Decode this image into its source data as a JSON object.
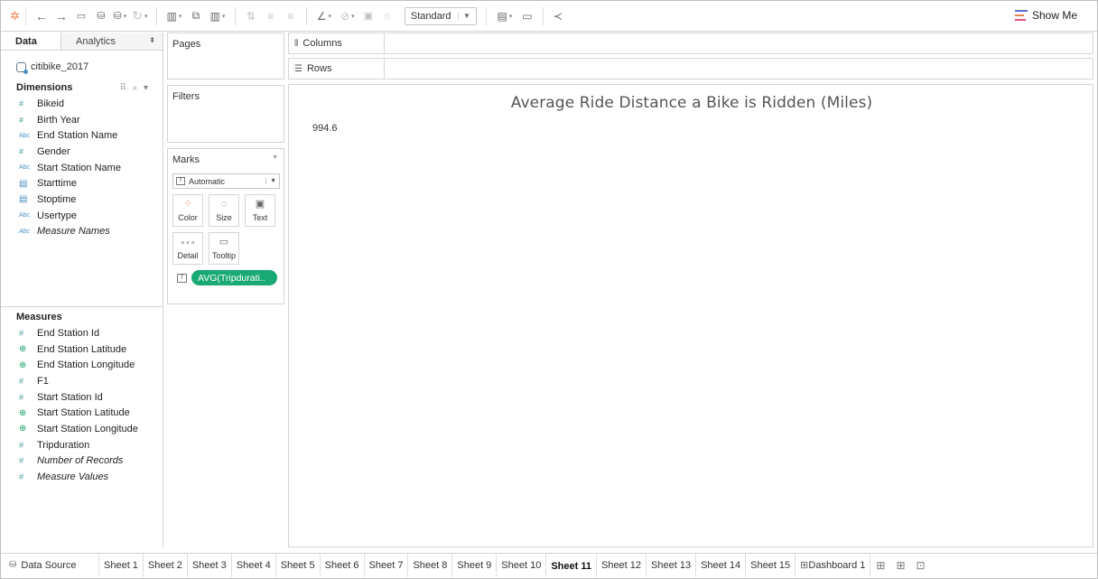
{
  "toolbar": {
    "fit_select": "Standard",
    "show_me": "Show Me",
    "colors": {
      "showme_bar1": "#5b6fd1",
      "showme_bar2": "#e8844f",
      "showme_bar3": "#e4547a"
    }
  },
  "data_pane": {
    "tabs": [
      "Data",
      "Analytics"
    ],
    "datasource": "citibike_2017",
    "dimensions_header": "Dimensions",
    "dimensions": [
      {
        "label": "Bikeid",
        "icon": "number-icon"
      },
      {
        "label": "Birth Year",
        "icon": "number-icon"
      },
      {
        "label": "End Station Name",
        "icon": "string-icon"
      },
      {
        "label": "Gender",
        "icon": "number-icon"
      },
      {
        "label": "Start Station Name",
        "icon": "string-icon"
      },
      {
        "label": "Starttime",
        "icon": "datetime-icon"
      },
      {
        "label": "Stoptime",
        "icon": "datetime-icon"
      },
      {
        "label": "Usertype",
        "icon": "string-icon"
      },
      {
        "label": "Measure Names",
        "icon": "string-icon"
      }
    ],
    "measures_header": "Measures",
    "measures": [
      {
        "label": "End Station Id",
        "icon": "number-icon"
      },
      {
        "label": "End Station Latitude",
        "icon": "globe-icon"
      },
      {
        "label": "End Station Longitude",
        "icon": "globe-icon"
      },
      {
        "label": "F1",
        "icon": "number-icon"
      },
      {
        "label": "Start Station Id",
        "icon": "number-icon"
      },
      {
        "label": "Start Station Latitude",
        "icon": "globe-icon"
      },
      {
        "label": "Start Station Longitude",
        "icon": "globe-icon"
      },
      {
        "label": "Tripduration",
        "icon": "number-icon"
      },
      {
        "label": "Number of Records",
        "icon": "number-icon"
      },
      {
        "label": "Measure Values",
        "icon": "number-icon"
      }
    ]
  },
  "cards": {
    "pages": "Pages",
    "filters": "Filters",
    "marks": "Marks",
    "mark_type": "Automatic",
    "mark_buttons": [
      "Color",
      "Size",
      "Text",
      "Detail",
      "Tooltip"
    ],
    "pill": "AVG(Tripdurati..",
    "pill_color": "#19a974"
  },
  "shelves": {
    "columns": "Columns",
    "rows": "Rows"
  },
  "view": {
    "title": "Average Ride Distance a Bike is Ridden (Miles)",
    "value": "994.6"
  },
  "bottom_tabs": {
    "data_source": "Data Source",
    "sheets": [
      "Sheet 1",
      "Sheet 2",
      "Sheet 3",
      "Sheet 4",
      "Sheet 5",
      "Sheet 6",
      "Sheet 7",
      "Sheet 8",
      "Sheet 9",
      "Sheet 10",
      "Sheet 11",
      "Sheet 12",
      "Sheet 13",
      "Sheet 14",
      "Sheet 15",
      "Dashboard 1"
    ],
    "active": "Sheet 11"
  }
}
